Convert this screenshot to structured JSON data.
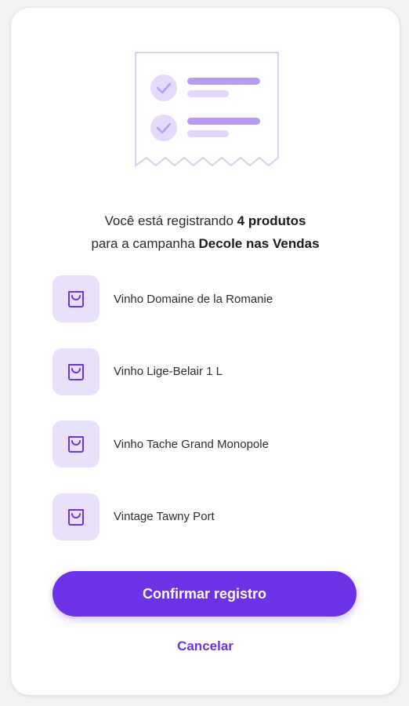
{
  "summary": {
    "line1_prefix": "Você está registrando ",
    "product_count": "4 produtos",
    "line2_prefix": "para a campanha ",
    "campaign_name": "Decole nas Vendas"
  },
  "products": [
    {
      "name": "Vinho Domaine de la Romanie",
      "icon": "shopping-bag-icon"
    },
    {
      "name": "Vinho Lige-Belair 1 L",
      "icon": "shopping-bag-icon"
    },
    {
      "name": "Vinho Tache Grand Monopole",
      "icon": "shopping-bag-icon"
    },
    {
      "name": "Vintage Tawny Port",
      "icon": "shopping-bag-icon"
    }
  ],
  "actions": {
    "confirm_label": "Confirmar registro",
    "cancel_label": "Cancelar"
  },
  "colors": {
    "accent": "#6c33e6",
    "icon_bg": "#e9e1fb",
    "illustration_stroke": "#d9cdf7",
    "illustration_bar": "#b89cf2",
    "illustration_bar_light": "#e2d6fa"
  }
}
